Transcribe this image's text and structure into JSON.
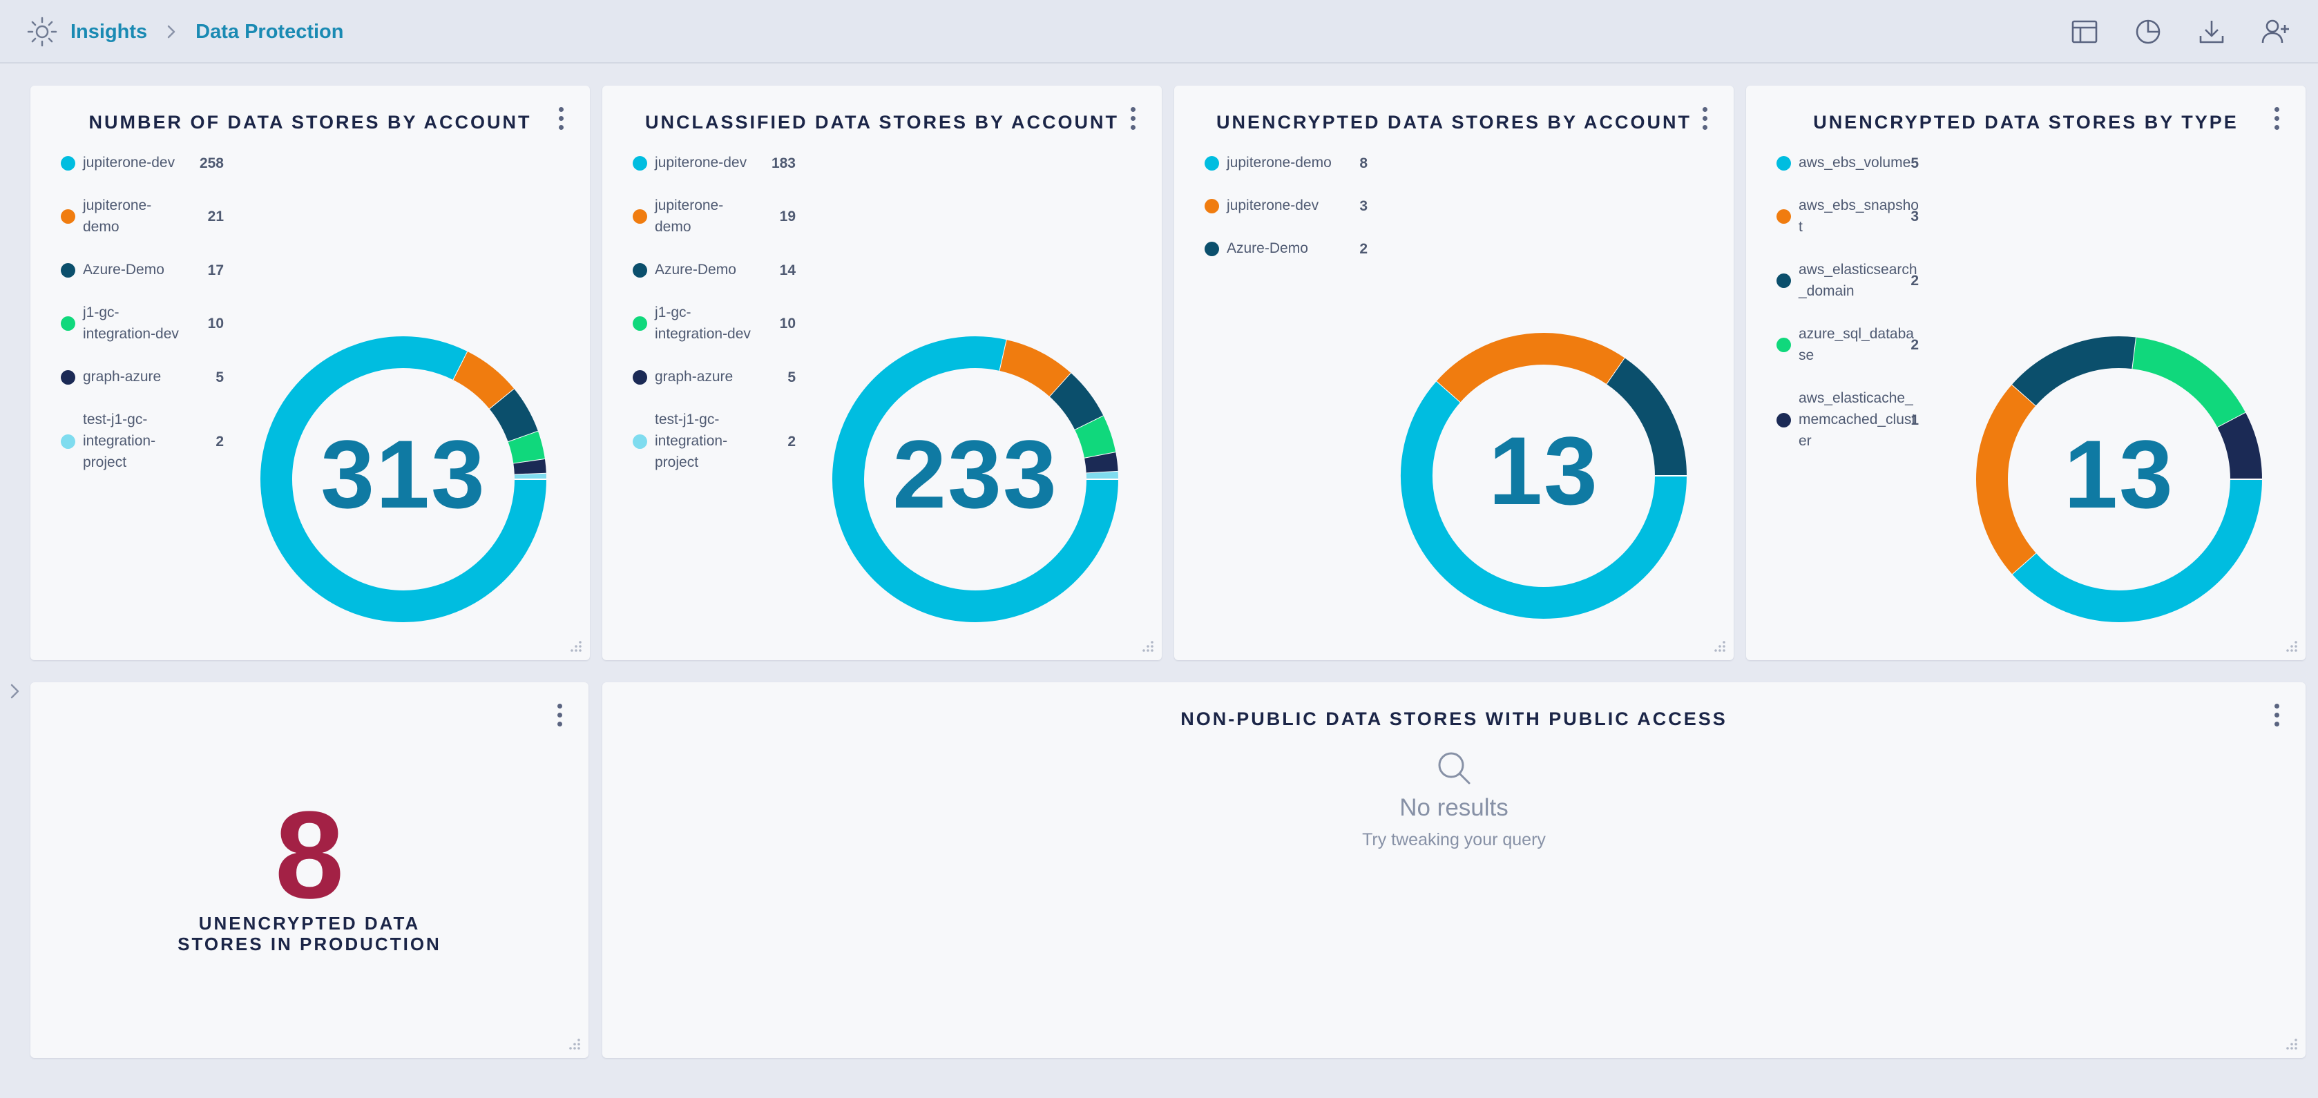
{
  "breadcrumb": {
    "root": "Insights",
    "current": "Data Protection"
  },
  "toolbar": {
    "icons": [
      "layout-icon",
      "pie-chart-icon",
      "download-icon",
      "add-user-icon"
    ]
  },
  "colors": {
    "cyan": "#00bde0",
    "orange": "#f07c0f",
    "teal": "#0b4f6c",
    "green": "#10d87c",
    "navy": "#1b2a55",
    "lightcyan": "#7fdcef",
    "accent": "#1a8ab3",
    "danger": "#a32145"
  },
  "widgets": [
    {
      "title": "NUMBER OF DATA STORES BY ACCOUNT",
      "total": "313",
      "legend": [
        {
          "label": [
            "jupiterone-dev"
          ],
          "value": "258",
          "color": "#00bde0"
        },
        {
          "label": [
            "jupiterone-",
            "demo"
          ],
          "value": "21",
          "color": "#f07c0f"
        },
        {
          "label": [
            "Azure-Demo"
          ],
          "value": "17",
          "color": "#0b4f6c"
        },
        {
          "label": [
            "j1-gc-",
            "integration-dev"
          ],
          "value": "10",
          "color": "#10d87c"
        },
        {
          "label": [
            "graph-azure"
          ],
          "value": "5",
          "color": "#1b2a55"
        },
        {
          "label": [
            "test-j1-gc-",
            "integration-",
            "project"
          ],
          "value": "2",
          "color": "#7fdcef"
        }
      ]
    },
    {
      "title": "UNCLASSIFIED DATA STORES BY ACCOUNT",
      "total": "233",
      "legend": [
        {
          "label": [
            "jupiterone-dev"
          ],
          "value": "183",
          "color": "#00bde0"
        },
        {
          "label": [
            "jupiterone-",
            "demo"
          ],
          "value": "19",
          "color": "#f07c0f"
        },
        {
          "label": [
            "Azure-Demo"
          ],
          "value": "14",
          "color": "#0b4f6c"
        },
        {
          "label": [
            "j1-gc-",
            "integration-dev"
          ],
          "value": "10",
          "color": "#10d87c"
        },
        {
          "label": [
            "graph-azure"
          ],
          "value": "5",
          "color": "#1b2a55"
        },
        {
          "label": [
            "test-j1-gc-",
            "integration-",
            "project"
          ],
          "value": "2",
          "color": "#7fdcef"
        }
      ]
    },
    {
      "title": "UNENCRYPTED DATA STORES BY ACCOUNT",
      "total": "13",
      "legend": [
        {
          "label": [
            "jupiterone-demo"
          ],
          "value": "8",
          "color": "#00bde0"
        },
        {
          "label": [
            "jupiterone-dev"
          ],
          "value": "3",
          "color": "#f07c0f"
        },
        {
          "label": [
            "Azure-Demo"
          ],
          "value": "2",
          "color": "#0b4f6c"
        }
      ]
    },
    {
      "title": "UNENCRYPTED DATA STORES BY TYPE",
      "total": "13",
      "legend": [
        {
          "label": [
            "aws_ebs_volume"
          ],
          "value": "5",
          "color": "#00bde0"
        },
        {
          "label": [
            "aws_ebs_snapsho",
            "t"
          ],
          "value": "3",
          "color": "#f07c0f"
        },
        {
          "label": [
            "aws_elasticsearch",
            "_domain"
          ],
          "value": "2",
          "color": "#0b4f6c"
        },
        {
          "label": [
            "azure_sql_databa",
            "se"
          ],
          "value": "2",
          "color": "#10d87c"
        },
        {
          "label": [
            "aws_elasticache_",
            "memcached_clust",
            "er"
          ],
          "value": "1",
          "color": "#1b2a55"
        }
      ]
    }
  ],
  "production": {
    "value": "8",
    "label_line1": "UNENCRYPTED DATA",
    "label_line2": "STORES IN PRODUCTION"
  },
  "public_access": {
    "title": "NON-PUBLIC DATA STORES WITH PUBLIC ACCESS",
    "empty_title": "No results",
    "empty_subtitle": "Try tweaking your query"
  }
}
